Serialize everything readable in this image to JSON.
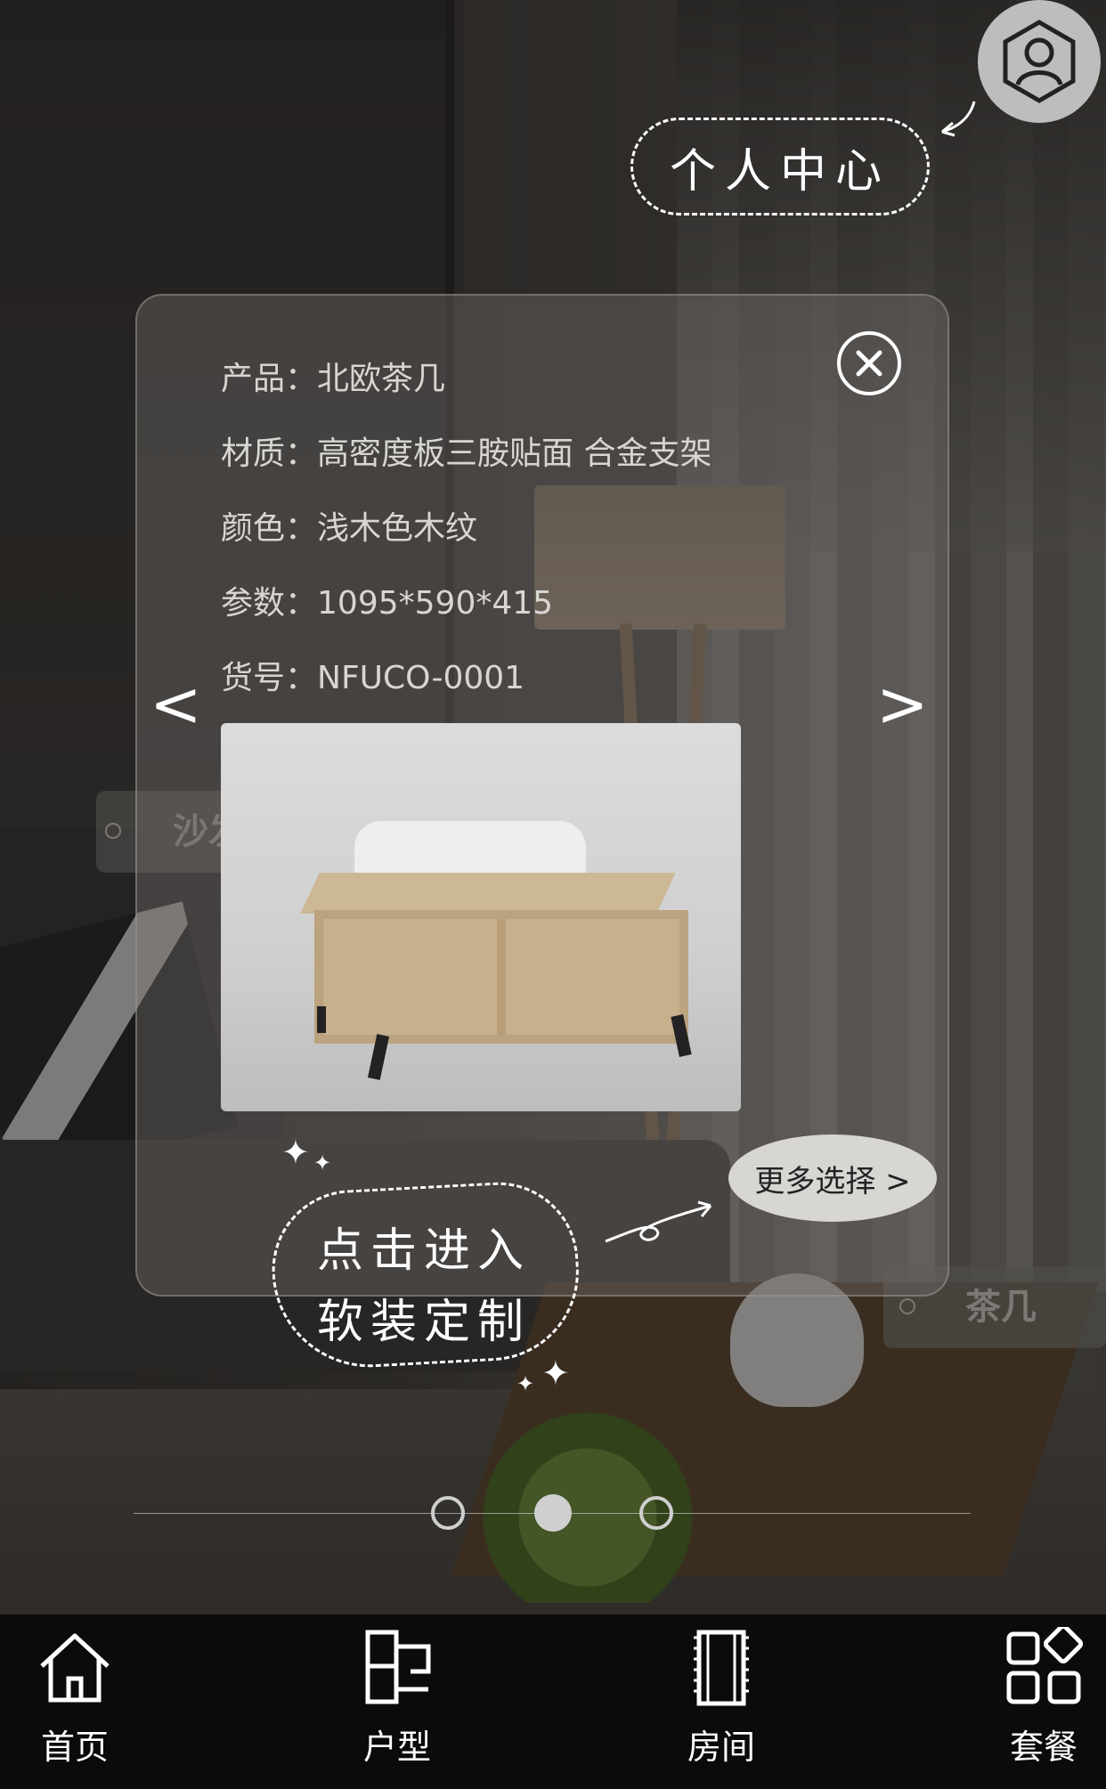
{
  "profile": {
    "callout_text": "个人中心",
    "icon": "user-icon"
  },
  "product": {
    "lines": [
      {
        "key": "产品：",
        "value": "北欧茶几"
      },
      {
        "key": "材质：",
        "value": "高密度板三胺贴面 合金支架"
      },
      {
        "key": "颜色：",
        "value": "浅木色木纹"
      },
      {
        "key": "参数：",
        "value": "1095*590*415"
      },
      {
        "key": "货号：",
        "value": "NFUCO-0001"
      }
    ],
    "more_label": "更多选择 >",
    "prev_label": "<",
    "next_label": ">"
  },
  "scene_tags": {
    "sofa": "沙发",
    "table": "茶几"
  },
  "enter_callout": {
    "line1": "点击进入",
    "line2": "软装定制"
  },
  "pager": {
    "current": 2,
    "total": 3
  },
  "bottom_nav": [
    {
      "label": "首页",
      "icon": "home-icon"
    },
    {
      "label": "户型",
      "icon": "floorplan-icon"
    },
    {
      "label": "房间",
      "icon": "room-icon"
    },
    {
      "label": "套餐",
      "icon": "package-icon"
    }
  ],
  "colors": {
    "accent": "#ffffff",
    "nav_bg": "#0b0b0b",
    "panel_text": "#d8d6d3"
  }
}
